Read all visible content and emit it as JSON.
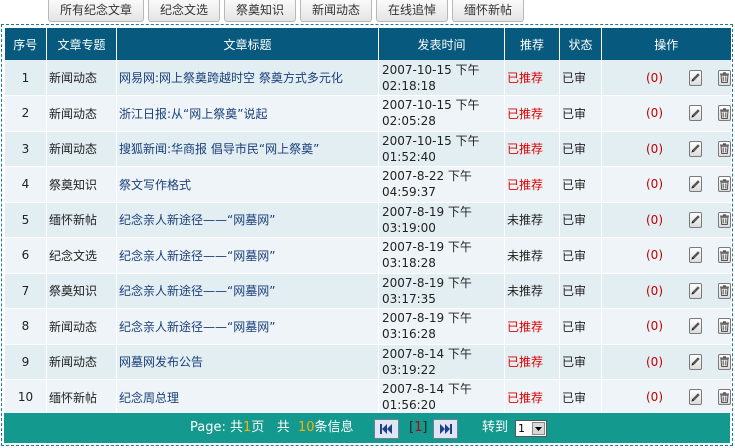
{
  "tabs": [
    "所有纪念文章",
    "纪念文选",
    "祭奠知识",
    "新闻动态",
    "在线追悼",
    "缅怀新帖"
  ],
  "table": {
    "headers": [
      "序号",
      "文章专题",
      "文章标题",
      "发表时间",
      "推荐",
      "状态",
      "操作"
    ],
    "rows": [
      {
        "no": "1",
        "topic": "新闻动态",
        "title": "网易网:网上祭奠跨越时空 祭奠方式多元化",
        "date": "2007-10-15 下午",
        "time": "02:18:18",
        "rec": "已推荐",
        "status": "已审",
        "count": "(0)"
      },
      {
        "no": "2",
        "topic": "新闻动态",
        "title": "浙江日报:从“网上祭奠”说起",
        "date": "2007-10-15 下午",
        "time": "02:05:28",
        "rec": "已推荐",
        "status": "已审",
        "count": "(0)"
      },
      {
        "no": "3",
        "topic": "新闻动态",
        "title": "搜狐新闻:华商报 倡导市民“网上祭奠”",
        "date": "2007-10-15 下午",
        "time": "01:52:40",
        "rec": "已推荐",
        "status": "已审",
        "count": "(0)"
      },
      {
        "no": "4",
        "topic": "祭奠知识",
        "title": "祭文写作格式",
        "date": "2007-8-22 下午",
        "time": "04:59:37",
        "rec": "已推荐",
        "status": "已审",
        "count": "(0)"
      },
      {
        "no": "5",
        "topic": "缅怀新帖",
        "title": "纪念亲人新途径——“网墓网”",
        "date": "2007-8-19 下午",
        "time": "03:19:00",
        "rec": "未推荐",
        "status": "已审",
        "count": "(0)"
      },
      {
        "no": "6",
        "topic": "纪念文选",
        "title": "纪念亲人新途径——“网墓网”",
        "date": "2007-8-19 下午",
        "time": "03:18:28",
        "rec": "未推荐",
        "status": "已审",
        "count": "(0)"
      },
      {
        "no": "7",
        "topic": "祭奠知识",
        "title": "纪念亲人新途径——“网墓网”",
        "date": "2007-8-19 下午",
        "time": "03:17:35",
        "rec": "未推荐",
        "status": "已审",
        "count": "(0)"
      },
      {
        "no": "8",
        "topic": "新闻动态",
        "title": "纪念亲人新途径——“网墓网”",
        "date": "2007-8-19 下午",
        "time": "03:16:28",
        "rec": "已推荐",
        "status": "已审",
        "count": "(0)"
      },
      {
        "no": "9",
        "topic": "新闻动态",
        "title": "网墓网发布公告",
        "date": "2007-8-14 下午",
        "time": "03:19:22",
        "rec": "已推荐",
        "status": "已审",
        "count": "(0)"
      },
      {
        "no": "10",
        "topic": "缅怀新帖",
        "title": "纪念周总理",
        "date": "2007-8-14 下午",
        "time": "01:56:20",
        "rec": "已推荐",
        "status": "已审",
        "count": "(0)"
      }
    ]
  },
  "footer": {
    "page_prefix": "Page: 共",
    "total_pages": "1",
    "page_suffix": "页",
    "total_prefix": "共",
    "total_records": "10",
    "total_suffix": "条信息",
    "current_page_open": "[",
    "current_page": "1",
    "current_page_close": "]",
    "goto_label": "转到",
    "goto_value": "1"
  },
  "colors": {
    "header_bg": "#075a7e",
    "footer_bg": "#14998f",
    "recommended": "#e00000",
    "link": "#1a3f7a"
  },
  "icons": {
    "comment": "users-comment-icon",
    "edit": "pencil-icon",
    "delete": "trash-icon",
    "first": "first-page-icon",
    "last": "last-page-icon",
    "dropdown": "dropdown-arrow-icon"
  }
}
